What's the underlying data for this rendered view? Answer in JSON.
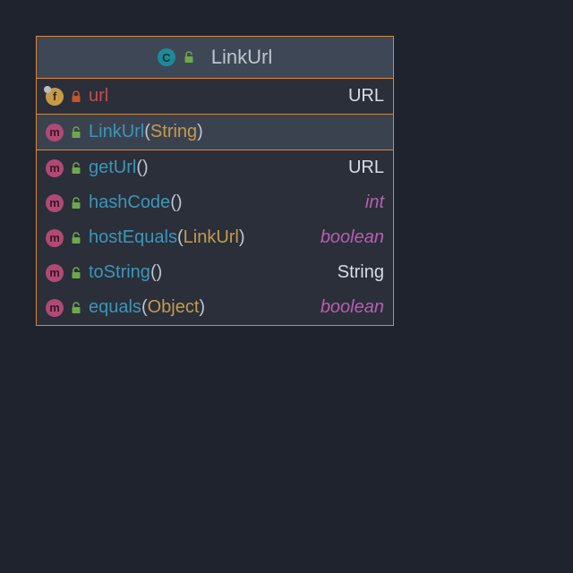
{
  "className": "LinkUrl",
  "icons": {
    "class": "C",
    "field": "f",
    "method": "m"
  },
  "field": {
    "name": "url",
    "type": "URL",
    "visibility": "private"
  },
  "constructor": {
    "name": "LinkUrl",
    "params": "String",
    "visibility": "public",
    "selected": true
  },
  "methods": [
    {
      "name": "getUrl",
      "params": "",
      "returnType": "URL",
      "primitive": false,
      "visibility": "public"
    },
    {
      "name": "hashCode",
      "params": "",
      "returnType": "int",
      "primitive": true,
      "visibility": "public"
    },
    {
      "name": "hostEquals",
      "params": "LinkUrl",
      "returnType": "boolean",
      "primitive": true,
      "visibility": "public"
    },
    {
      "name": "toString",
      "params": "",
      "returnType": "String",
      "primitive": false,
      "visibility": "public"
    },
    {
      "name": "equals",
      "params": "Object",
      "returnType": "boolean",
      "primitive": true,
      "visibility": "public"
    }
  ]
}
